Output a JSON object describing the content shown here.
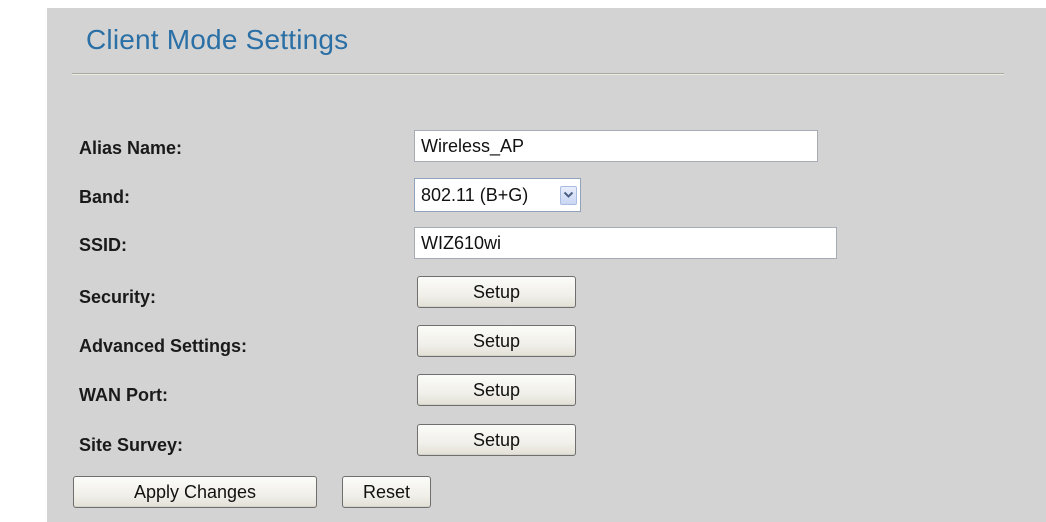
{
  "page": {
    "title": "Client Mode Settings"
  },
  "form": {
    "alias_name": {
      "label": "Alias Name:",
      "value": "Wireless_AP"
    },
    "band": {
      "label": "Band:",
      "selected": "802.11 (B+G)"
    },
    "ssid": {
      "label": "SSID:",
      "value": "WIZ610wi"
    },
    "security": {
      "label": "Security:",
      "button": "Setup"
    },
    "advanced_settings": {
      "label": "Advanced Settings:",
      "button": "Setup"
    },
    "wan_port": {
      "label": "WAN Port:",
      "button": "Setup"
    },
    "site_survey": {
      "label": "Site Survey:",
      "button": "Setup"
    }
  },
  "actions": {
    "apply_label": "Apply Changes",
    "reset_label": "Reset"
  },
  "icons": {
    "dropdown": "chevron-down-icon"
  },
  "colors": {
    "background": "#d3d3d3",
    "title": "#2a6fa5"
  }
}
